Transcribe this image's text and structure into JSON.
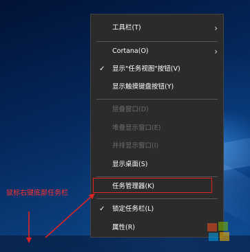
{
  "context_menu": {
    "items": [
      {
        "label": "工具栏(T)",
        "checked": false,
        "submenu": true,
        "disabled": false
      },
      {
        "label": "Cortana(O)",
        "checked": false,
        "submenu": true,
        "disabled": false
      },
      {
        "label": "显示\"任务视图\"按钮(V)",
        "checked": true,
        "submenu": false,
        "disabled": false
      },
      {
        "label": "显示触摸键盘按钮(Y)",
        "checked": false,
        "submenu": false,
        "disabled": false
      },
      {
        "label": "层叠窗口(D)",
        "checked": false,
        "submenu": false,
        "disabled": true
      },
      {
        "label": "堆叠显示窗口(E)",
        "checked": false,
        "submenu": false,
        "disabled": true
      },
      {
        "label": "并排显示窗口(I)",
        "checked": false,
        "submenu": false,
        "disabled": true
      },
      {
        "label": "显示桌面(S)",
        "checked": false,
        "submenu": false,
        "disabled": false
      },
      {
        "label": "任务管理器(K)",
        "checked": false,
        "submenu": false,
        "disabled": false,
        "highlighted": true
      },
      {
        "label": "锁定任务栏(L)",
        "checked": true,
        "submenu": false,
        "disabled": false
      },
      {
        "label": "属性(R)",
        "checked": false,
        "submenu": false,
        "disabled": false
      }
    ],
    "check_glyph": "✓",
    "submenu_glyph": "›"
  },
  "annotation": {
    "text": "鼠标右键底部任务栏",
    "color": "#ff3030"
  },
  "colors": {
    "menu_background": "#2b2b2b",
    "menu_text": "#ffffff",
    "menu_disabled_text": "#6d6d6d",
    "highlight_border": "#e02424"
  }
}
